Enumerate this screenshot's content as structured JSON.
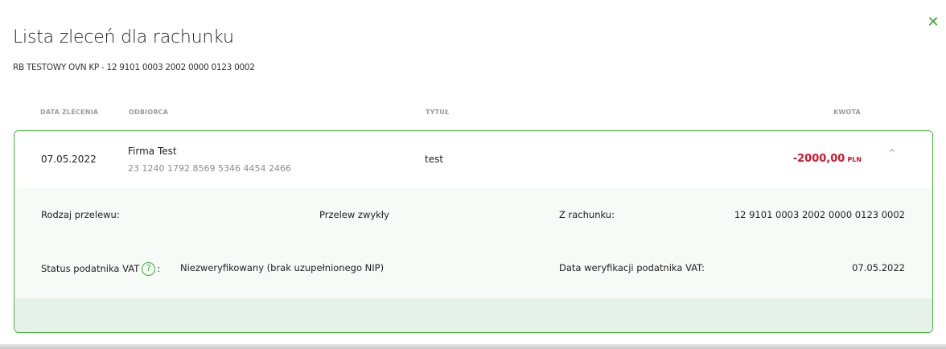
{
  "dialog": {
    "close_symbol": "✕",
    "title": "Lista zleceń dla rachunku",
    "account_line": "RB TESTOWY OVN KP - 12 9101 0003 2002 0000 0123 0002"
  },
  "columns": {
    "date": "DATA ZLECENIA",
    "recipient": "ODBIORCA",
    "title": "TYTUŁ",
    "amount": "KWOTA"
  },
  "order": {
    "date": "07.05.2022",
    "recipient_name": "Firma Test",
    "recipient_account": "23 1240 1792 8569 5346 4454 2466",
    "title": "test",
    "amount": "-2000,00",
    "currency": "PLN",
    "collapse_symbol": "^",
    "details": {
      "transfer_type_label": "Rodzaj przelewu:",
      "transfer_type_value": "Przelew zwykły",
      "from_account_label": "Z rachunku:",
      "from_account_value": "12 9101 0003 2002 0000 0123 0002",
      "vat_status_label": "Status podatnika VAT",
      "help_symbol": "?",
      "vat_status_colon": ":",
      "vat_status_value": "Niezweryfikowany (brak uzupełnionego NIP)",
      "vat_verification_label": "Data weryfikacji podatnika VAT:",
      "vat_verification_value": "07.05.2022"
    }
  },
  "colors": {
    "accent_green": "#3aaa35",
    "amount_red": "#d3142b",
    "details_bg": "#f6fbf7",
    "footer_bg": "#e6f2e9"
  },
  "icons": {
    "close": "close-icon",
    "collapse": "chevron-up-icon",
    "help": "help-icon"
  }
}
